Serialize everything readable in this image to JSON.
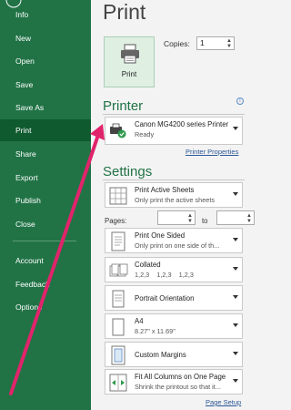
{
  "sidebar": {
    "items": [
      {
        "label": "Info"
      },
      {
        "label": "New"
      },
      {
        "label": "Open"
      },
      {
        "label": "Save"
      },
      {
        "label": "Save As"
      },
      {
        "label": "Print"
      },
      {
        "label": "Share"
      },
      {
        "label": "Export"
      },
      {
        "label": "Publish"
      },
      {
        "label": "Close"
      },
      {
        "label": "Account"
      },
      {
        "label": "Feedback"
      },
      {
        "label": "Options"
      }
    ],
    "active": "Print"
  },
  "main": {
    "title": "Print",
    "print_button": {
      "label": "Print"
    },
    "copies": {
      "label": "Copies:",
      "value": "1"
    },
    "printer": {
      "section_title": "Printer",
      "name": "Canon MG4200 series Printer",
      "status": "Ready",
      "properties_link": "Printer Properties"
    },
    "settings": {
      "section_title": "Settings",
      "sheets": {
        "title": "Print Active Sheets",
        "subtitle": "Only print the active sheets"
      },
      "pages": {
        "label": "Pages:",
        "to_label": "to"
      },
      "sided": {
        "title": "Print One Sided",
        "subtitle": "Only print on one side of th..."
      },
      "collated": {
        "title": "Collated",
        "subtitle": "1,2,3    1,2,3    1,2,3"
      },
      "orientation": {
        "title": "Portrait Orientation"
      },
      "paper": {
        "title": "A4",
        "subtitle": "8.27\" x 11.69\""
      },
      "margins": {
        "title": "Custom Margins"
      },
      "scaling": {
        "title": "Fit All Columns on One Page",
        "subtitle": "Shrink the printout so that it..."
      },
      "page_setup_link": "Page Setup"
    }
  },
  "colors": {
    "sidebar": "#217346",
    "sidebar_active": "#0f5a2f",
    "accent_text": "#217346",
    "annotation_arrow": "#e0246b"
  }
}
